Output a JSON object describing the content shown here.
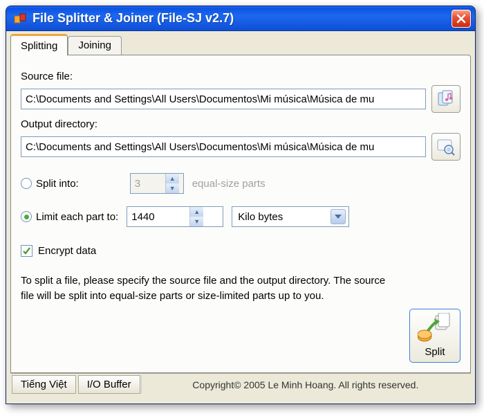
{
  "window": {
    "title": "File Splitter & Joiner (File-SJ v2.7)"
  },
  "tabs": {
    "splitting": "Splitting",
    "joining": "Joining"
  },
  "form": {
    "source_label": "Source file:",
    "source_value": "C:\\Documents and Settings\\All Users\\Documentos\\Mi música\\Música de mu",
    "output_label": "Output directory:",
    "output_value": "C:\\Documents and Settings\\All Users\\Documentos\\Mi música\\Música de mu",
    "split_into_label": "Split into:",
    "split_into_value": "3",
    "split_into_suffix": "equal-size parts",
    "limit_label": "Limit each part to:",
    "limit_value": "1440",
    "limit_unit": "Kilo bytes",
    "encrypt_label": "Encrypt data",
    "encrypt_checked": true,
    "help_text": "To split a file, please specify the source file and the output directory. The source file will be split into equal-size parts or size-limited parts up to you.",
    "split_button": "Split"
  },
  "status": {
    "lang_button": "Tiếng Việt",
    "io_buffer_button": "I/O Buffer",
    "copyright": "Copyright© 2005 Le Minh Hoang. All rights reserved."
  }
}
